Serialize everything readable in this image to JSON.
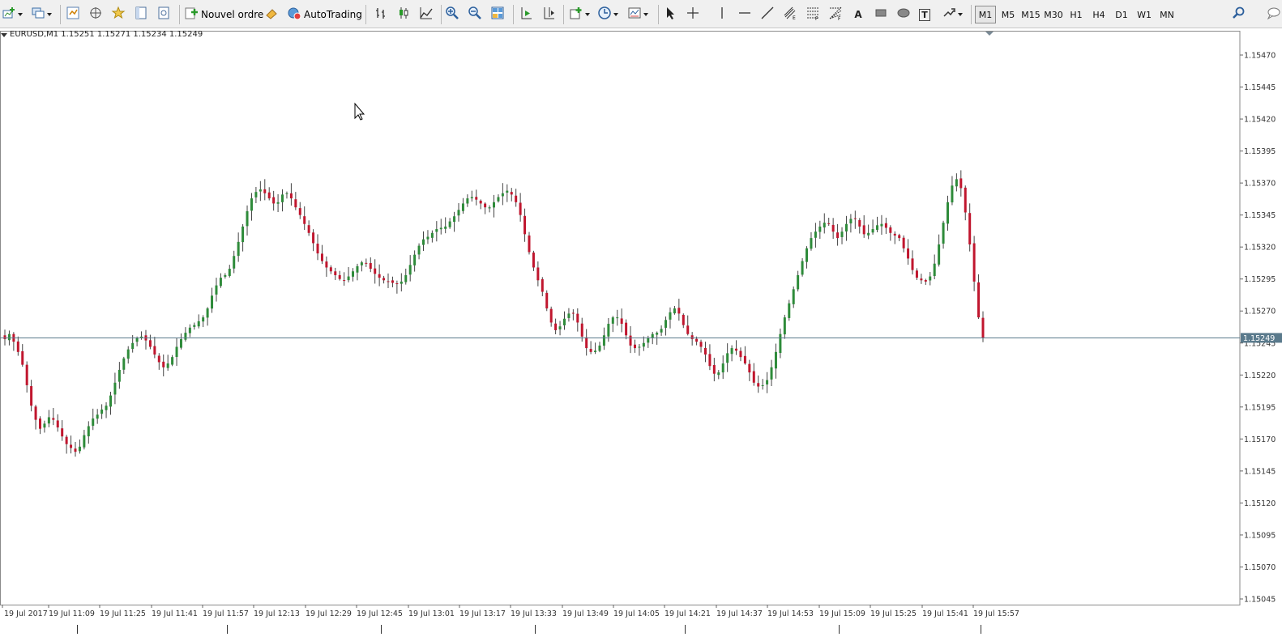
{
  "toolbar": {
    "new_order_label": "Nouvel ordre",
    "autotrading_label": "AutoTrading",
    "timeframes": [
      "M1",
      "M5",
      "M15",
      "M30",
      "H1",
      "H4",
      "D1",
      "W1",
      "MN"
    ],
    "active_timeframe": "M1",
    "tools": [
      "new-chart-icon",
      "profiles-icon",
      "market-watch-icon",
      "navigator-icon",
      "favorites-icon",
      "data-window-icon",
      "strategy-tester-icon",
      "new-order-icon",
      "metaeditor-icon",
      "autotrading-icon",
      "bar-chart-icon",
      "candlestick-icon",
      "line-chart-icon",
      "zoom-in-icon",
      "zoom-out-icon",
      "tile-windows-icon",
      "auto-scroll-icon",
      "chart-shift-icon",
      "indicators-icon",
      "periods-icon",
      "templates-icon",
      "cursor-icon",
      "crosshair-icon",
      "vertical-line-icon",
      "horizontal-line-icon",
      "trendline-icon",
      "equidistant-channel-icon",
      "fibonacci-retracement-icon",
      "fibonacci-fan-icon",
      "text-icon",
      "rectangle-icon",
      "ellipse-icon",
      "text-label-icon",
      "arrows-icon",
      "search-icon",
      "chat-icon"
    ],
    "text_tool_label": "A",
    "label_tool_label": "T"
  },
  "chart_info": {
    "symbol_line": "EURUSD,M1  1.15251 1.15271 1.15234 1.15249"
  },
  "chart_data": {
    "type": "candlestick",
    "symbol": "EURUSD",
    "timeframe": "M1",
    "current_price": "1.15249",
    "ylim": [
      1.1504,
      1.15485
    ],
    "y_ticks": [
      "1.15470",
      "1.15445",
      "1.15420",
      "1.15395",
      "1.15370",
      "1.15345",
      "1.15320",
      "1.15295",
      "1.15270",
      "1.15245",
      "1.15220",
      "1.15195",
      "1.15170",
      "1.15145",
      "1.15120",
      "1.15095",
      "1.15070",
      "1.15045"
    ],
    "x_ticks": [
      "19 Jul 2017",
      "19 Jul 11:09",
      "19 Jul 11:25",
      "19 Jul 11:41",
      "19 Jul 11:57",
      "19 Jul 12:13",
      "19 Jul 12:29",
      "19 Jul 12:45",
      "19 Jul 13:01",
      "19 Jul 13:17",
      "19 Jul 13:33",
      "19 Jul 13:49",
      "19 Jul 14:05",
      "19 Jul 14:21",
      "19 Jul 14:37",
      "19 Jul 14:53",
      "19 Jul 15:09",
      "19 Jul 15:25",
      "19 Jul 15:41",
      "19 Jul 15:57"
    ],
    "bull_color": "#2e8b3a",
    "bear_color": "#c0162e",
    "wick_color": "#444444",
    "price_line_color": "#5a7a8c",
    "close_path": [
      1.15248,
      1.15252,
      1.15246,
      1.15238,
      1.15228,
      1.15212,
      1.15196,
      1.15185,
      1.15178,
      1.15182,
      1.15187,
      1.15185,
      1.15179,
      1.15172,
      1.15166,
      1.15163,
      1.1516,
      1.15164,
      1.15173,
      1.1518,
      1.15186,
      1.15189,
      1.15193,
      1.15196,
      1.15204,
      1.15214,
      1.15224,
      1.15233,
      1.1524,
      1.15245,
      1.15249,
      1.1525,
      1.15247,
      1.15242,
      1.15236,
      1.1523,
      1.15226,
      1.15229,
      1.15234,
      1.15242,
      1.15248,
      1.15253,
      1.15257,
      1.15259,
      1.15262,
      1.15265,
      1.15272,
      1.15282,
      1.1529,
      1.15296,
      1.15298,
      1.15303,
      1.15313,
      1.15324,
      1.15336,
      1.15348,
      1.15358,
      1.15363,
      1.15365,
      1.15362,
      1.15358,
      1.15354,
      1.15355,
      1.15361,
      1.15362,
      1.15358,
      1.15351,
      1.15345,
      1.15338,
      1.15331,
      1.15323,
      1.15315,
      1.15309,
      1.15304,
      1.15301,
      1.15298,
      1.15295,
      1.15294,
      1.15297,
      1.15301,
      1.15305,
      1.15308,
      1.15307,
      1.15303,
      1.15299,
      1.15296,
      1.15294,
      1.15293,
      1.15292,
      1.15291,
      1.15293,
      1.15298,
      1.15306,
      1.15314,
      1.15321,
      1.15326,
      1.15328,
      1.15331,
      1.15334,
      1.15335,
      1.15336,
      1.1534,
      1.15344,
      1.15349,
      1.15354,
      1.15358,
      1.15359,
      1.15357,
      1.15354,
      1.15351,
      1.15351,
      1.15355,
      1.15359,
      1.15362,
      1.15364,
      1.15361,
      1.15355,
      1.15345,
      1.1533,
      1.15316,
      1.15304,
      1.15294,
      1.15285,
      1.15272,
      1.15261,
      1.15255,
      1.15258,
      1.15264,
      1.15268,
      1.15268,
      1.15261,
      1.1525,
      1.15241,
      1.15238,
      1.15239,
      1.15243,
      1.15251,
      1.1526,
      1.15265,
      1.15265,
      1.1526,
      1.15251,
      1.15243,
      1.15241,
      1.15242,
      1.15245,
      1.15249,
      1.15252,
      1.15253,
      1.15256,
      1.15263,
      1.15269,
      1.15272,
      1.15268,
      1.15259,
      1.15252,
      1.15248,
      1.15246,
      1.15242,
      1.15236,
      1.15227,
      1.15221,
      1.15222,
      1.15229,
      1.15237,
      1.15241,
      1.15239,
      1.15234,
      1.15229,
      1.15222,
      1.15214,
      1.15211,
      1.15212,
      1.15216,
      1.15226,
      1.15238,
      1.15252,
      1.15265,
      1.15276,
      1.15287,
      1.15298,
      1.15309,
      1.15319,
      1.15327,
      1.15332,
      1.15336,
      1.15339,
      1.15338,
      1.15332,
      1.15327,
      1.15332,
      1.15338,
      1.15342,
      1.15342,
      1.15336,
      1.1533,
      1.15331,
      1.15334,
      1.15337,
      1.15338,
      1.15335,
      1.15331,
      1.15329,
      1.15327,
      1.15319,
      1.15311,
      1.15302,
      1.15296,
      1.15294,
      1.15293,
      1.15297,
      1.15307,
      1.15322,
      1.15339,
      1.15355,
      1.15368,
      1.15373,
      1.15366,
      1.15347,
      1.15322,
      1.15293,
      1.15265,
      1.15249
    ]
  }
}
